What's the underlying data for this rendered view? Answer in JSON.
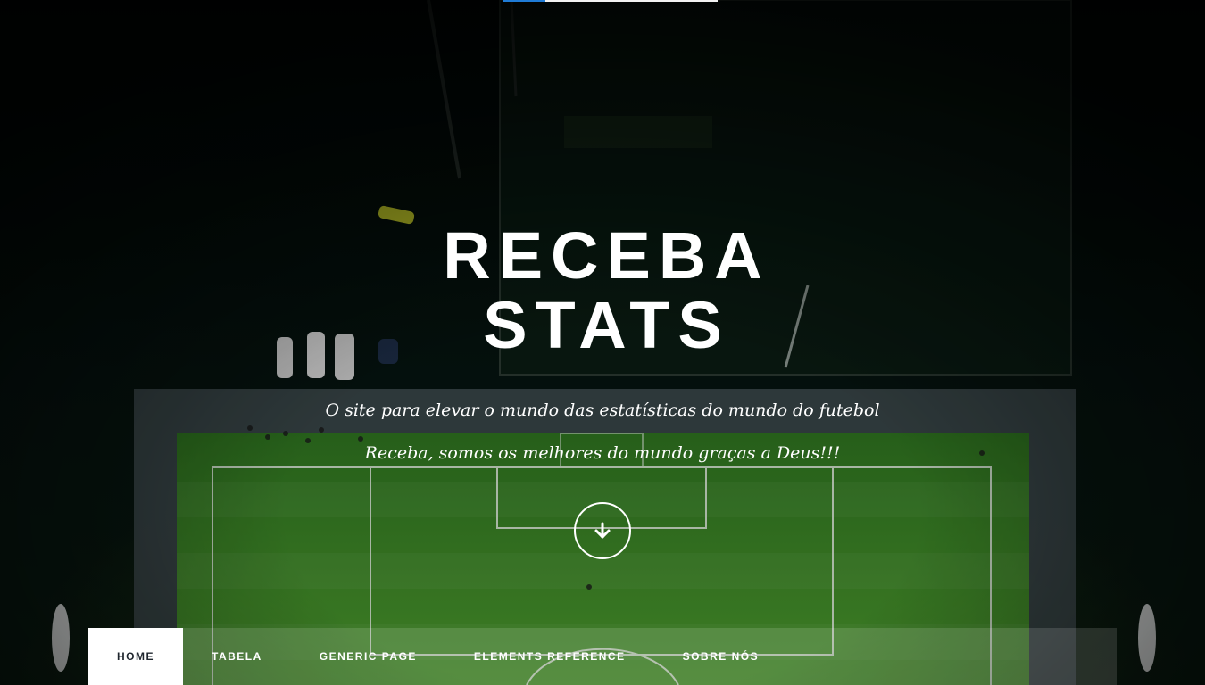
{
  "hero": {
    "title_line_1": "RECEBA",
    "title_line_2": "STATS",
    "tagline_1": "O site para elevar o mundo das estatísticas do mundo do futebol",
    "tagline_2": "Receba, somos os melhores do mundo graças a Deus!!!",
    "scroll_icon": "arrow-down-icon"
  },
  "top_progress": {
    "percent": 20,
    "fill_color": "#1f7bd6",
    "track_color": "#f2f2f2"
  },
  "nav": {
    "items": [
      {
        "label": "HOME",
        "active": true
      },
      {
        "label": "TABELA",
        "active": false
      },
      {
        "label": "GENERIC PAGE",
        "active": false
      },
      {
        "label": "ELEMENTS REFERENCE",
        "active": false
      },
      {
        "label": "SOBRE NÓS",
        "active": false
      }
    ]
  },
  "colors": {
    "background": "#050c0a",
    "field_green": "#3f8a26",
    "text": "#ffffff",
    "active_nav_text": "#1e252d"
  }
}
